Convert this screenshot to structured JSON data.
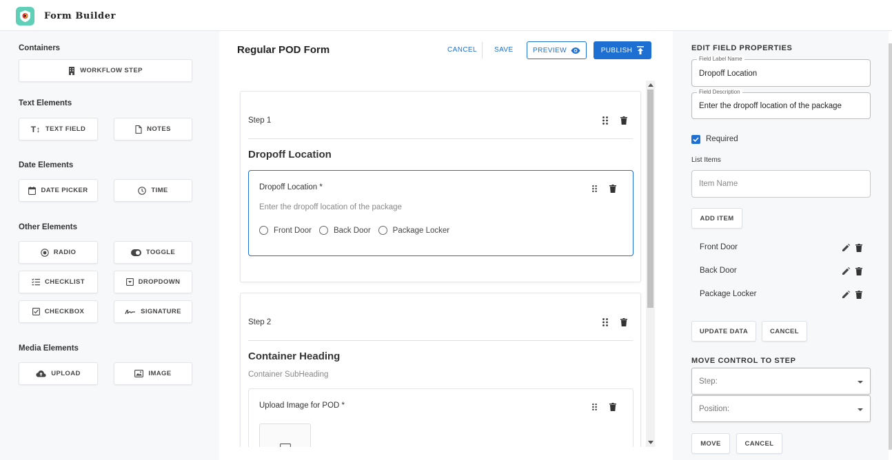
{
  "app": {
    "title": "Form Builder"
  },
  "palette": {
    "sections": [
      {
        "title": "Containers",
        "items": [
          {
            "label": "WORKFLOW STEP",
            "icon": "building-icon"
          }
        ]
      },
      {
        "title": "Text Elements",
        "items": [
          {
            "label": "TEXT FIELD",
            "icon": "text-height-icon"
          },
          {
            "label": "NOTES",
            "icon": "document-icon"
          }
        ]
      },
      {
        "title": "Date Elements",
        "items": [
          {
            "label": "DATE PICKER",
            "icon": "calendar-icon"
          },
          {
            "label": "TIME",
            "icon": "clock-icon"
          }
        ]
      },
      {
        "title": "Other Elements",
        "items": [
          {
            "label": "RADIO",
            "icon": "radio-icon"
          },
          {
            "label": "TOGGLE",
            "icon": "toggle-icon"
          },
          {
            "label": "CHECKLIST",
            "icon": "checklist-icon"
          },
          {
            "label": "DROPDOWN",
            "icon": "dropdown-icon"
          },
          {
            "label": "CHECKBOX",
            "icon": "checkbox-icon"
          },
          {
            "label": "SIGNATURE",
            "icon": "signature-icon"
          }
        ]
      },
      {
        "title": "Media Elements",
        "items": [
          {
            "label": "UPLOAD",
            "icon": "cloud-upload-icon"
          },
          {
            "label": "IMAGE",
            "icon": "image-icon"
          }
        ]
      }
    ]
  },
  "editor": {
    "form_title": "Regular POD Form",
    "cancel_label": "CANCEL",
    "save_label": "SAVE",
    "preview_label": "PREVIEW",
    "publish_label": "PUBLISH",
    "steps": [
      {
        "label": "Step 1",
        "heading": "Dropoff Location",
        "field": {
          "label": "Dropoff Location *",
          "description": "Enter the dropoff location of the package",
          "options": [
            "Front Door",
            "Back Door",
            "Package Locker"
          ]
        }
      },
      {
        "label": "Step 2",
        "heading": "Container Heading",
        "subheading": "Container SubHeading",
        "field": {
          "label": "Upload Image for POD *"
        }
      }
    ]
  },
  "properties": {
    "title": "EDIT FIELD PROPERTIES",
    "field_label_legend": "Field Label Name",
    "field_label_value": "Dropoff Location",
    "field_desc_legend": "Field Description",
    "field_desc_value": "Enter the dropoff location of the package",
    "required_label": "Required",
    "required_checked": true,
    "list_items_title": "List Items",
    "item_name_placeholder": "Item Name",
    "add_item_label": "ADD ITEM",
    "list_items": [
      "Front Door",
      "Back Door",
      "Package Locker"
    ],
    "update_label": "UPDATE DATA",
    "cancel_label": "CANCEL",
    "move_title": "MOVE CONTROL TO STEP",
    "step_placeholder": "Step:",
    "position_placeholder": "Position:",
    "move_label": "MOVE",
    "move_cancel_label": "CANCEL"
  },
  "colors": {
    "accent": "#1e6fd2",
    "logo": "#5fcfb8"
  }
}
